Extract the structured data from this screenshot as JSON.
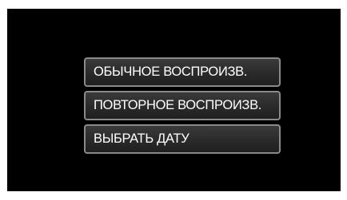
{
  "menu": {
    "items": [
      {
        "label": "ОБЫЧНОЕ ВОСПРОИЗВ."
      },
      {
        "label": "ПОВТОРНОЕ ВОСПРОИЗВ."
      },
      {
        "label": "ВЫБРАТЬ ДАТУ"
      }
    ]
  },
  "colors": {
    "screen_background": "#000000",
    "button_border": "#8a8a8a",
    "button_fill": "#2a2a2a",
    "button_text": "#ffffff"
  }
}
